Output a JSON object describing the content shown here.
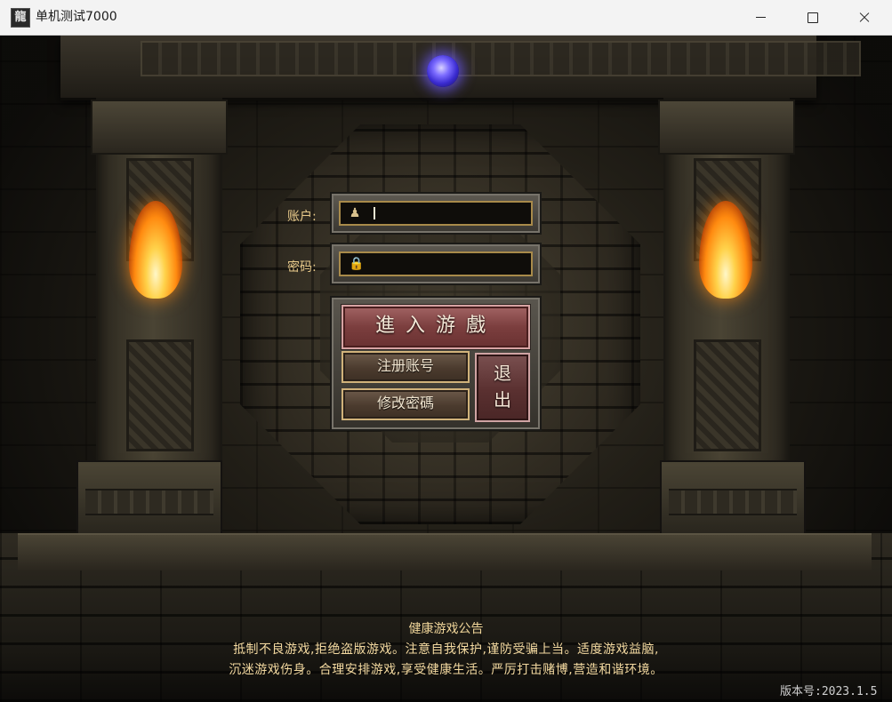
{
  "window": {
    "title": "单机测试7000",
    "icon_text": "龍"
  },
  "login": {
    "account_label": "账户:",
    "password_label": "密码:",
    "account_value": "",
    "password_value": "",
    "account_icon": "user-icon",
    "password_icon": "lock-icon"
  },
  "buttons": {
    "enter": "進入游戲",
    "register": "注册账号",
    "change_password": "修改密碼",
    "exit_top": "退",
    "exit_bottom": "出"
  },
  "notice": {
    "title": "健康游戏公告",
    "line1": "抵制不良游戏,拒绝盗版游戏。注意自我保护,谨防受骗上当。适度游戏益脑,",
    "line2": "沉迷游戏伤身。合理安排游戏,享受健康生活。严厉打击赌博,营造和谐环境。"
  },
  "version": "版本号:2023.1.5",
  "colors": {
    "label_gold": "#e7c98a",
    "notice_gold": "#f3d9a0",
    "enter_button": "#7b3e3e",
    "orb": "#7c6cff"
  }
}
